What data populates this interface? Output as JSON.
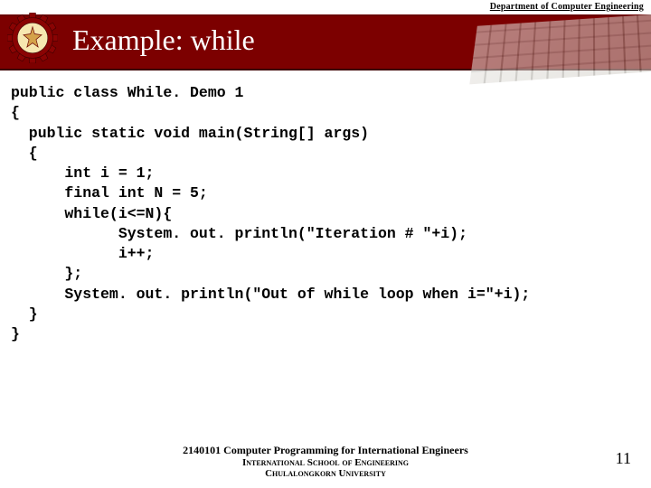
{
  "header": {
    "department": "Department of Computer Engineering",
    "title": "Example: while"
  },
  "code": {
    "lines": [
      "public class While. Demo 1",
      "{",
      "  public static void main(String[] args)",
      "  {",
      "      int i = 1;",
      "      final int N = 5;",
      "      while(i<=N){",
      "            System. out. println(\"Iteration # \"+i);",
      "            i++;",
      "      };",
      "      System. out. println(\"Out of while loop when i=\"+i);",
      "  }",
      "}"
    ]
  },
  "footer": {
    "line1": "2140101 Computer Programming for International Engineers",
    "line2": "International School of Engineering",
    "line3": "Chulalongkorn University"
  },
  "page_number": "11"
}
